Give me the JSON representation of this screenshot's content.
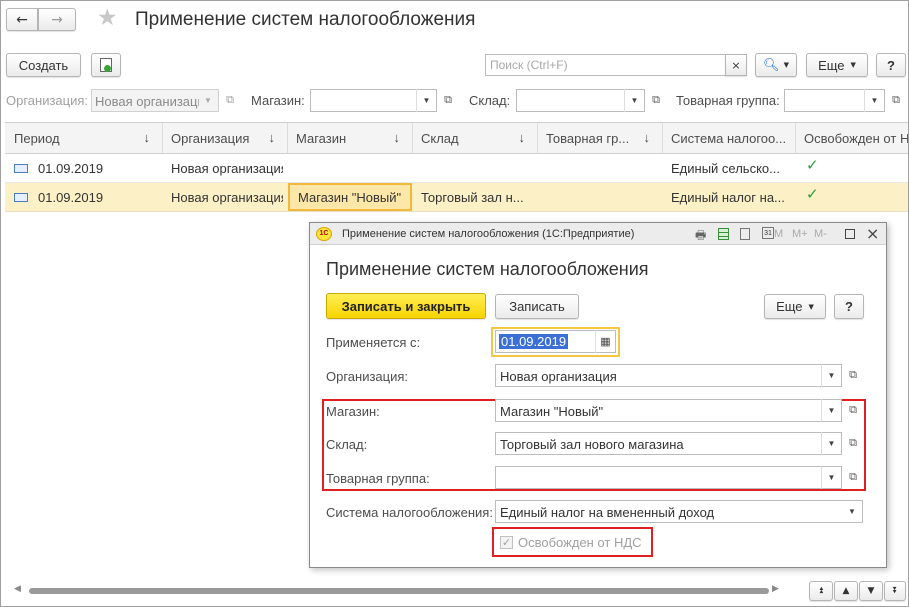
{
  "window": {
    "title": "Применение систем налогообложения"
  },
  "toolbar": {
    "create_label": "Создать",
    "search_placeholder": "Поиск (Ctrl+F)",
    "more_label": "Еще",
    "help_label": "?"
  },
  "filters": {
    "organization_label": "Организация:",
    "organization_value": "Новая организация",
    "store_label": "Магазин:",
    "store_value": "",
    "warehouse_label": "Склад:",
    "warehouse_value": "",
    "group_label": "Товарная группа:",
    "group_value": ""
  },
  "table": {
    "columns": [
      "Период",
      "Организация",
      "Магазин",
      "Склад",
      "Товарная гр...",
      "Система налогоо...",
      "Освобожден от Н"
    ],
    "rows": [
      {
        "period": "01.09.2019",
        "organization": "Новая организация",
        "store": "",
        "warehouse": "",
        "group": "",
        "system": "Единый сельско...",
        "vat_exempt": true
      },
      {
        "period": "01.09.2019",
        "organization": "Новая организация",
        "store": "Магазин \"Новый\"",
        "warehouse": "Торговый зал н...",
        "group": "",
        "system": "Единый налог на...",
        "vat_exempt": true
      }
    ]
  },
  "dialog": {
    "titlebar": "Применение систем налогообложения  (1С:Предприятие)",
    "heading": "Применение систем налогообложения",
    "save_close_label": "Записать и закрыть",
    "save_label": "Записать",
    "more_label": "Еще",
    "help_label": "?",
    "applies_from_label": "Применяется с:",
    "applies_from_value": "01.09.2019",
    "organization_label": "Организация:",
    "organization_value": "Новая организация",
    "store_label": "Магазин:",
    "store_value": "Магазин \"Новый\"",
    "warehouse_label": "Склад:",
    "warehouse_value": "Торговый зал нового магазина",
    "group_label": "Товарная группа:",
    "group_value": "",
    "tax_system_label": "Система налогообложения:",
    "tax_system_value": "Единый налог на вмененный доход",
    "vat_exempt_label": "Освобожден от НДС",
    "vat_exempt_checked": true,
    "mem_buttons": [
      "M",
      "M+",
      "M-"
    ]
  },
  "colors": {
    "accent_yellow": "#fde33b",
    "selected_row": "#fbf0c6",
    "red_frame": "#e02020",
    "check_green": "#2a9d3a"
  }
}
